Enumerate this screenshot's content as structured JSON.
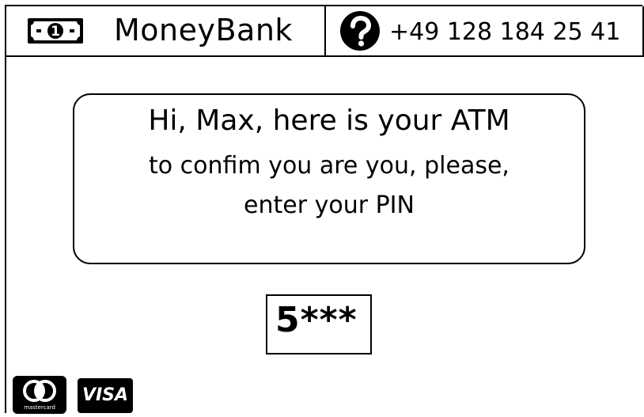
{
  "header": {
    "brand_icon": "banknote-icon",
    "brand_icon_text": "1",
    "brand_name": "MoneyBank",
    "help_icon": "question-circle-icon",
    "phone": "+49 128 184 25 41"
  },
  "message": {
    "line1": "Hi, Max, here is your ATM",
    "line2": "to confim you are you, please,",
    "line3": "enter your PIN"
  },
  "pin": {
    "value": "5***"
  },
  "payment_logos": {
    "mastercard_label": "mastercard",
    "visa_label": "VISA"
  },
  "colors": {
    "ink": "#000000",
    "background": "#ffffff"
  }
}
